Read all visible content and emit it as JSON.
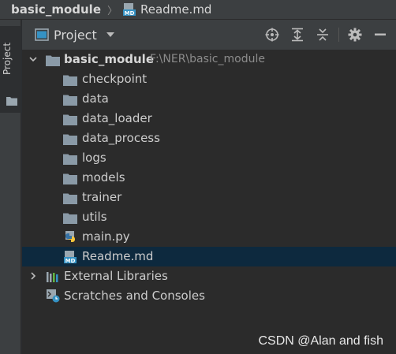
{
  "breadcrumb": {
    "project": "basic_module",
    "file": "Readme.md",
    "file_icon": "markdown-file-icon"
  },
  "toolstrip": {
    "tab_label": "Project",
    "tab_icon": "folder-icon"
  },
  "panel": {
    "view_label": "Project",
    "tools": [
      "locate-target-icon",
      "expand-all-icon",
      "collapse-all-icon",
      "gear-icon",
      "minimize-icon"
    ]
  },
  "tree": {
    "root": {
      "label": "basic_module",
      "path": "F:\\NER\\basic_module",
      "expanded": true
    },
    "folders": [
      "checkpoint",
      "data",
      "data_loader",
      "data_process",
      "logs",
      "models",
      "trainer",
      "utils"
    ],
    "files": [
      {
        "label": "main.py",
        "icon": "python-file-icon"
      },
      {
        "label": "Readme.md",
        "icon": "markdown-file-icon",
        "selected": true
      }
    ],
    "external_libraries": "External Libraries",
    "scratches": "Scratches and Consoles"
  },
  "colors": {
    "folder": "#8a9aa7",
    "selection": "#0d293e",
    "panel_bg": "#2b2b2b",
    "header_bg": "#3c3f41"
  },
  "watermark": "CSDN @Alan and fish"
}
